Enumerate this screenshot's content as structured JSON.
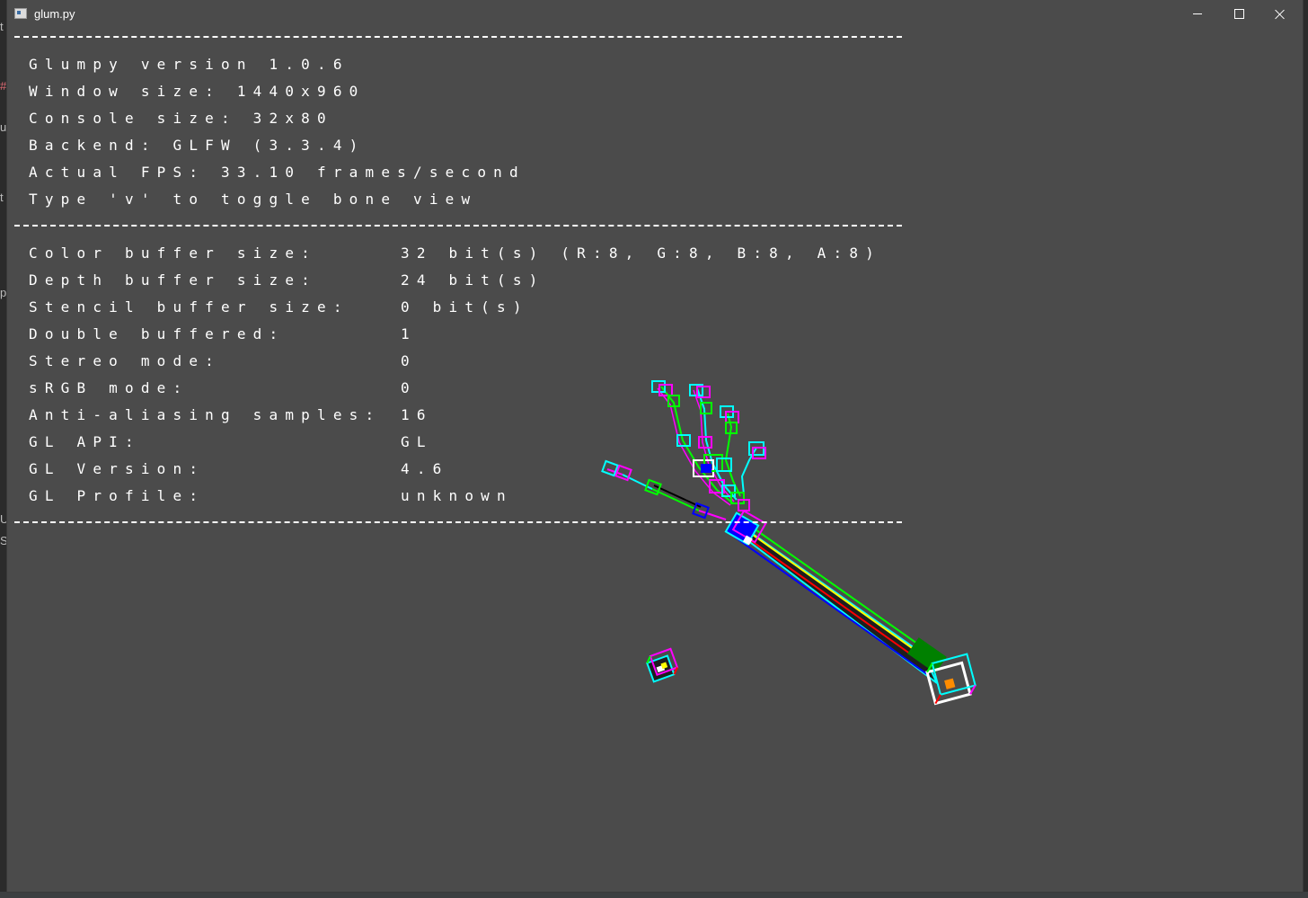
{
  "window": {
    "title": "glum.py",
    "controls": {
      "minimize": "minimize",
      "maximize": "maximize",
      "close": "close"
    }
  },
  "background_fragments": [
    "t",
    "#",
    "u",
    "t",
    "p",
    "U",
    "S"
  ],
  "console": {
    "header_lines": [
      "Glumpy version 1.0.6",
      "Window size: 1440x960",
      "Console size: 32x80",
      "Backend: GLFW (3.3.4)",
      "Actual FPS: 33.10 frames/second",
      "Type 'v' to toggle bone view"
    ],
    "info": [
      {
        "label": "Color buffer size:",
        "value": "32 bit(s) (R:8, G:8, B:8, A:8)"
      },
      {
        "label": "Depth buffer size:",
        "value": "24 bit(s)"
      },
      {
        "label": "Stencil buffer size:",
        "value": "0 bit(s)"
      },
      {
        "label": "Double buffered:",
        "value": "1"
      },
      {
        "label": "Stereo mode:",
        "value": "0"
      },
      {
        "label": "sRGB mode:",
        "value": "0"
      },
      {
        "label": "Anti-aliasing samples:",
        "value": "16"
      },
      {
        "label": "GL API:",
        "value": "GL"
      },
      {
        "label": "GL Version:",
        "value": "4.6"
      },
      {
        "label": "GL Profile:",
        "value": "unknown"
      }
    ]
  },
  "scene": {
    "description_icon": "skeleton-hand-bone-view",
    "colors": {
      "background": "#4b4b4b",
      "text": "#ffffff",
      "accent_cyan": "#00ffff",
      "accent_magenta": "#ff00ff",
      "accent_green": "#00ff00",
      "accent_blue": "#0000ff",
      "accent_red": "#ff0000",
      "accent_yellow": "#ffff00"
    }
  }
}
